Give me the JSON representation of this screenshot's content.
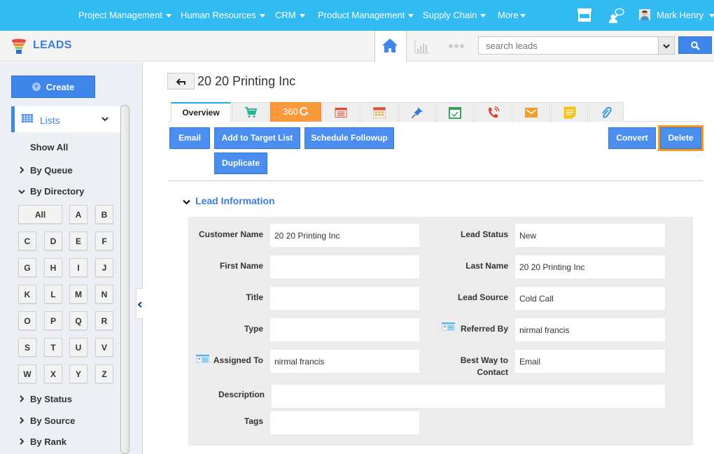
{
  "topnav": {
    "menu": [
      {
        "label": "Project Management"
      },
      {
        "label": "Human Resources"
      },
      {
        "label": "CRM"
      },
      {
        "label": "Product Management"
      },
      {
        "label": "Supply Chain"
      },
      {
        "label": "More"
      }
    ],
    "user_name": "Mark Henry",
    "icons": [
      "store-icon",
      "chat-user-icon",
      "avatar"
    ]
  },
  "subbar": {
    "app_title": "LEADS",
    "search_placeholder": "search leads",
    "icons": [
      "home-icon",
      "chart-icon",
      "more-dots-icon",
      "search-icon"
    ]
  },
  "sidebar": {
    "create_label": "Create",
    "lists_label": "Lists",
    "show_all": "Show All",
    "by_queue": "By Queue",
    "by_directory": "By Directory",
    "letters": [
      "All",
      "A",
      "B",
      "C",
      "D",
      "E",
      "F",
      "G",
      "H",
      "I",
      "J",
      "K",
      "L",
      "M",
      "N",
      "O",
      "P",
      "Q",
      "R",
      "S",
      "T",
      "U",
      "V",
      "W",
      "X",
      "Y",
      "Z"
    ],
    "by_status": "By Status",
    "by_source": "By Source",
    "by_rank": "By Rank"
  },
  "record": {
    "title": "20 20 Printing Inc",
    "tabs": [
      {
        "label": "Overview",
        "active": true
      },
      {
        "icon": "cart-icon"
      },
      {
        "label": "360",
        "icon": "refresh-icon",
        "color": "#fa9a3c"
      },
      {
        "icon": "newspaper-icon"
      },
      {
        "icon": "calendar-icon"
      },
      {
        "icon": "pin-icon"
      },
      {
        "icon": "task-check-icon"
      },
      {
        "icon": "phone-icon"
      },
      {
        "icon": "mail-icon"
      },
      {
        "icon": "note-icon"
      },
      {
        "icon": "paperclip-icon"
      }
    ],
    "actions": {
      "email": "Email",
      "add_target": "Add to Target List",
      "schedule": "Schedule Followup",
      "duplicate": "Duplicate",
      "convert": "Convert",
      "delete": "Delete"
    },
    "section_title": "Lead Information",
    "fields": {
      "customer_name": {
        "label": "Customer Name",
        "value": "20 20 Printing Inc"
      },
      "lead_status": {
        "label": "Lead Status",
        "value": "New"
      },
      "first_name": {
        "label": "First Name",
        "value": ""
      },
      "last_name": {
        "label": "Last Name",
        "value": "20 20 Printing Inc"
      },
      "title": {
        "label": "Title",
        "value": ""
      },
      "lead_source": {
        "label": "Lead Source",
        "value": "Cold Call"
      },
      "type": {
        "label": "Type",
        "value": ""
      },
      "referred_by": {
        "label": "Referred By",
        "value": "nirmal francis"
      },
      "assigned_to": {
        "label": "Assigned To",
        "value": "nirmal francis"
      },
      "best_way_1": {
        "label": "Best Way to"
      },
      "best_way_2": {
        "label": "Contact"
      },
      "best_way": {
        "value": "Email"
      },
      "description": {
        "label": "Description",
        "value": ""
      },
      "tags": {
        "label": "Tags",
        "value": ""
      }
    }
  },
  "colors": {
    "topbar": "#31bbf1",
    "primary": "#4b8ef0",
    "accent_orange": "#fa9a3c",
    "delete_outline": "#f59a1b",
    "title_blue": "#3b7de0"
  }
}
